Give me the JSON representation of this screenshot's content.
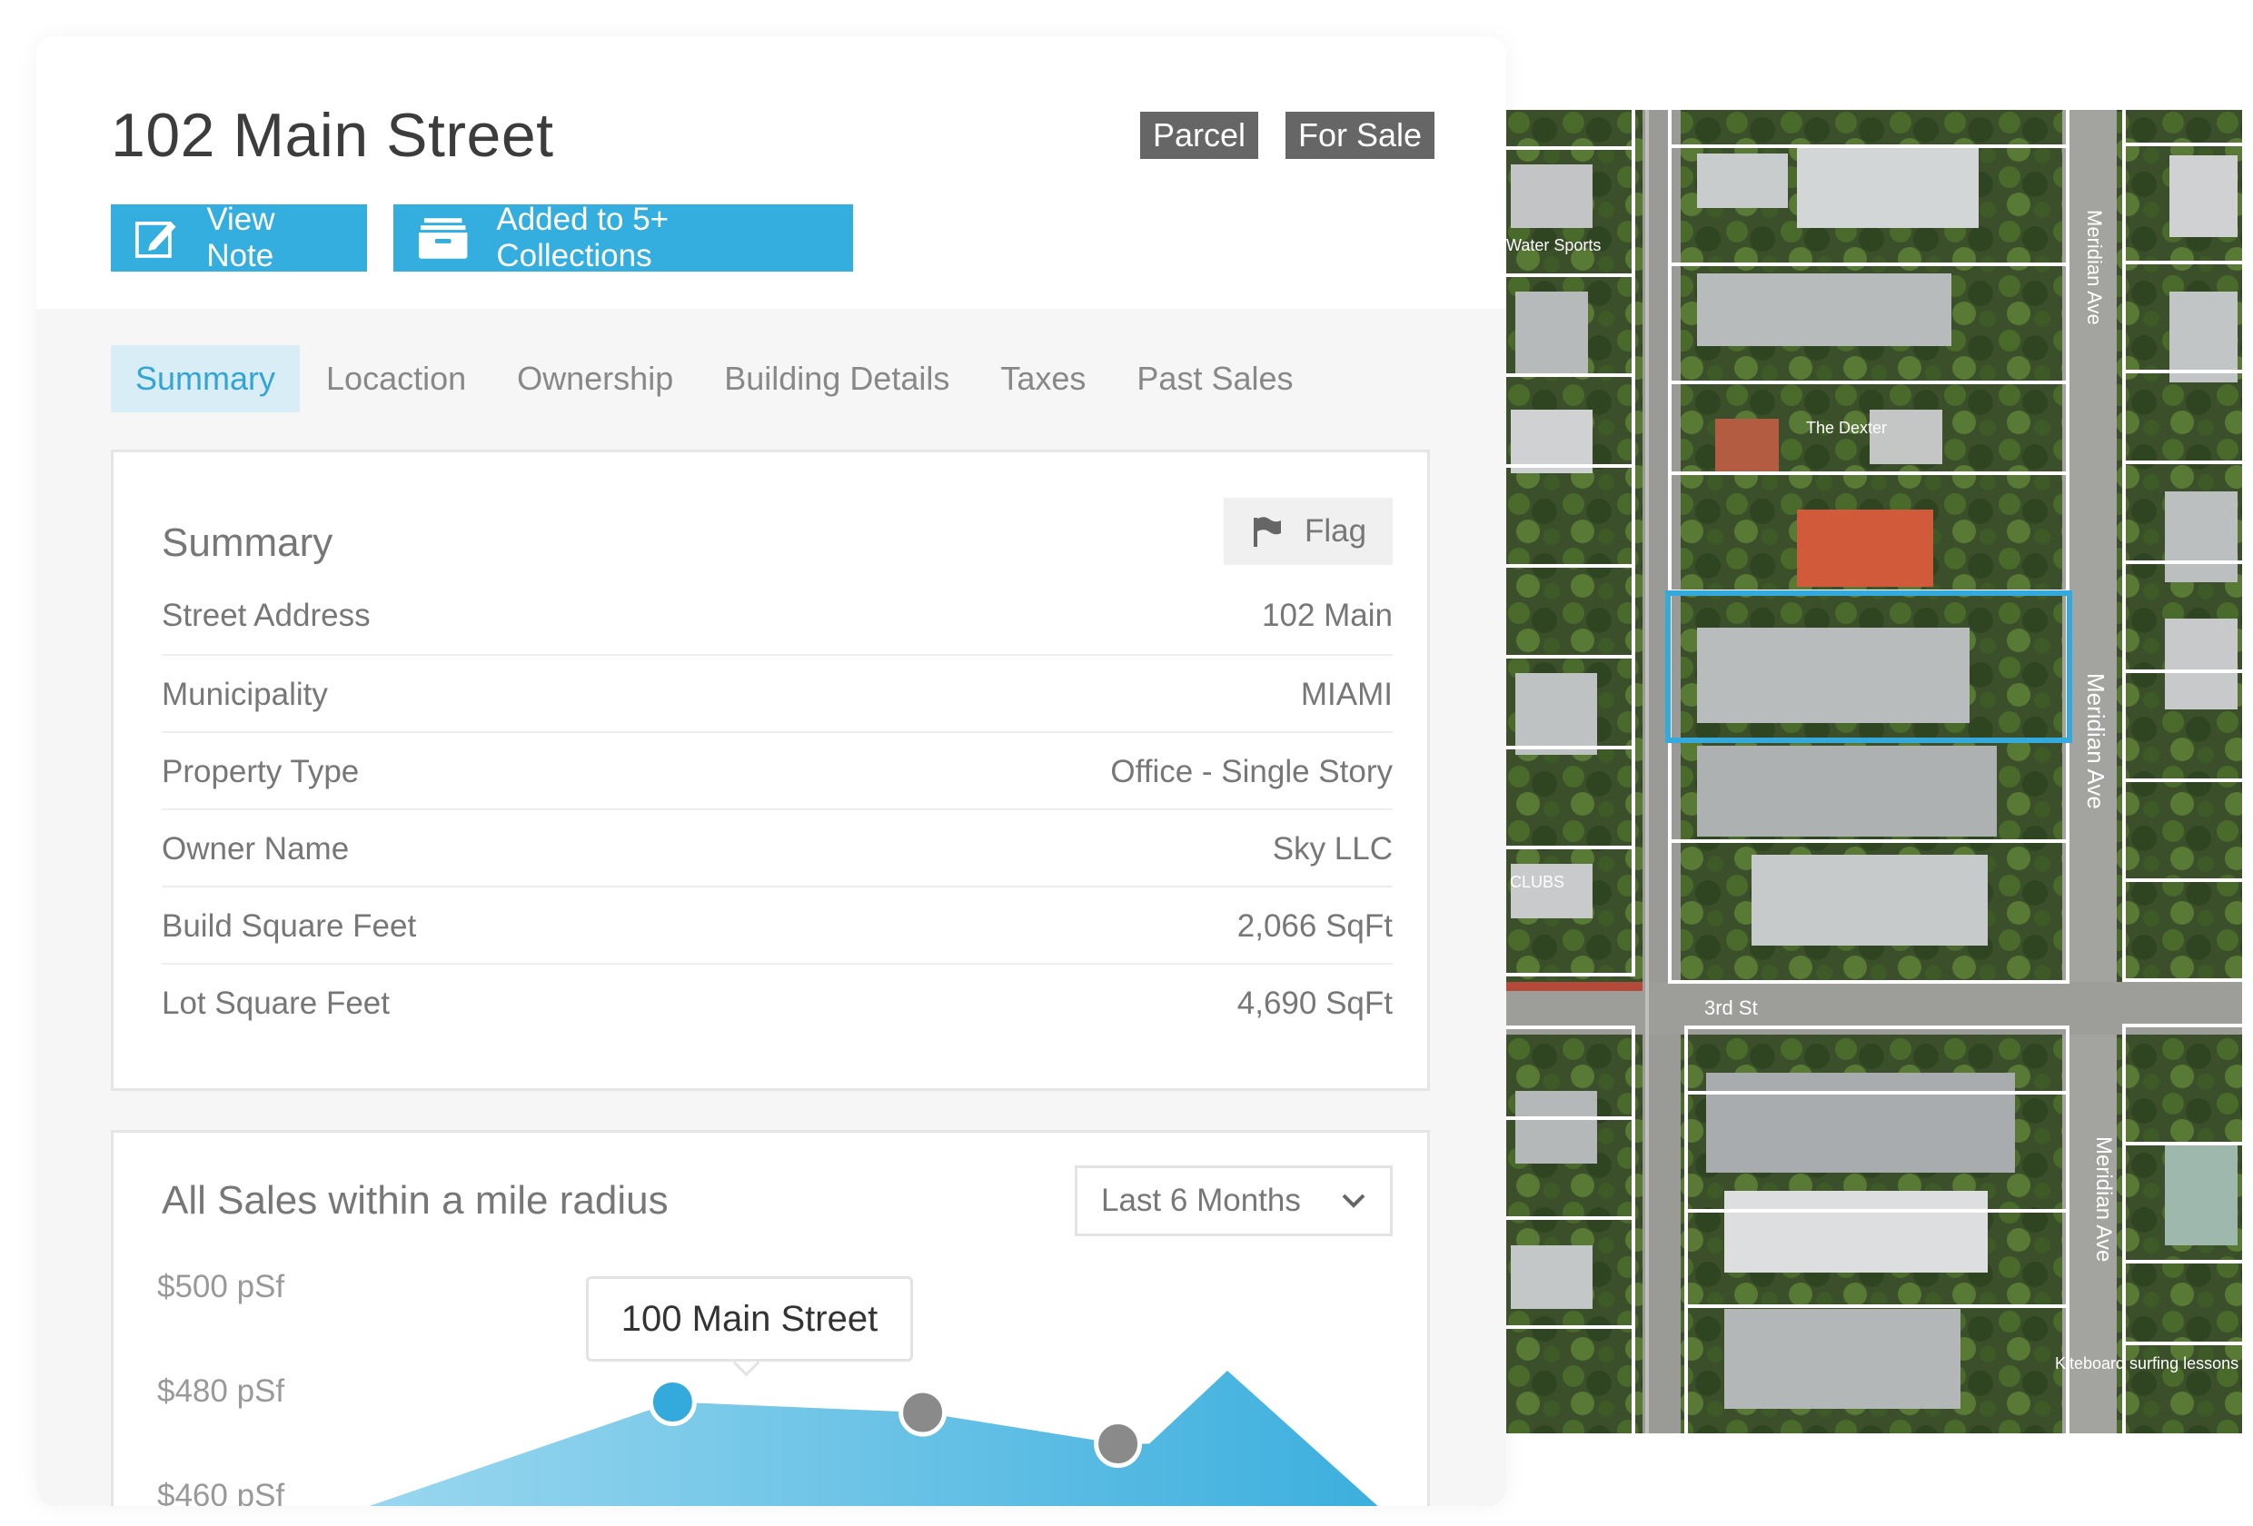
{
  "header": {
    "title": "102 Main Street",
    "badges": [
      "Parcel",
      "For Sale"
    ],
    "view_note_label": "View Note",
    "collections_label": "Added to 5+ Collections"
  },
  "tabs": [
    {
      "label": "Summary",
      "active": true
    },
    {
      "label": "Locaction",
      "active": false
    },
    {
      "label": "Ownership",
      "active": false
    },
    {
      "label": "Building Details",
      "active": false
    },
    {
      "label": "Taxes",
      "active": false
    },
    {
      "label": "Past Sales",
      "active": false
    }
  ],
  "summary": {
    "title": "Summary",
    "flag_label": "Flag",
    "rows": [
      {
        "label": "Street Address",
        "value": "102 Main"
      },
      {
        "label": "Municipality",
        "value": "MIAMI"
      },
      {
        "label": "Property Type",
        "value": "Office - Single Story"
      },
      {
        "label": "Owner Name",
        "value": "Sky LLC"
      },
      {
        "label": "Build Square Feet",
        "value": "2,066 SqFt"
      },
      {
        "label": "Lot Square Feet",
        "value": "4,690 SqFt"
      }
    ]
  },
  "sales": {
    "title": "All Sales within a mile radius",
    "range_selected": "Last 6 Months",
    "tooltip": "100 Main Street"
  },
  "chart_data": {
    "type": "area",
    "title": "All Sales within a mile radius",
    "y_tick_labels": [
      "$500 pSf",
      "$480 pSf",
      "$460 pSf"
    ],
    "y_ticks": [
      500,
      480,
      460
    ],
    "series": [
      {
        "values": [
          {
            "x": 0.0,
            "y": 458
          },
          {
            "x": 0.39,
            "y": 478
          },
          {
            "x": 0.71,
            "y": 476
          },
          {
            "x": 0.96,
            "y": 470
          },
          {
            "x": 1.0,
            "y": 470
          },
          {
            "x": 1.1,
            "y": 484
          }
        ]
      }
    ],
    "highlighted_points": [
      {
        "x": 0.39,
        "y": 478,
        "label": "100 Main Street",
        "selected": true
      },
      {
        "x": 0.71,
        "y": 476,
        "selected": false
      },
      {
        "x": 0.96,
        "y": 470,
        "selected": false
      }
    ],
    "colors": {
      "fill_top": "#9ad7ef",
      "fill_bottom": "#38addd",
      "selected": "#33a9dc",
      "point": "#8a8a8a"
    }
  },
  "map": {
    "street_labels": [
      "Meridian Ave",
      "Meridian Ave",
      "Meridian Ave",
      "3rd St"
    ],
    "poi_labels": [
      "Water Sports",
      "The Dexter",
      "CLUBS",
      "Kiteboard surfing lessons"
    ],
    "highlight_color": "#33a9dc"
  },
  "colors": {
    "accent": "#33aede",
    "badge": "#666666",
    "tab_active_bg": "#d9edf6"
  }
}
